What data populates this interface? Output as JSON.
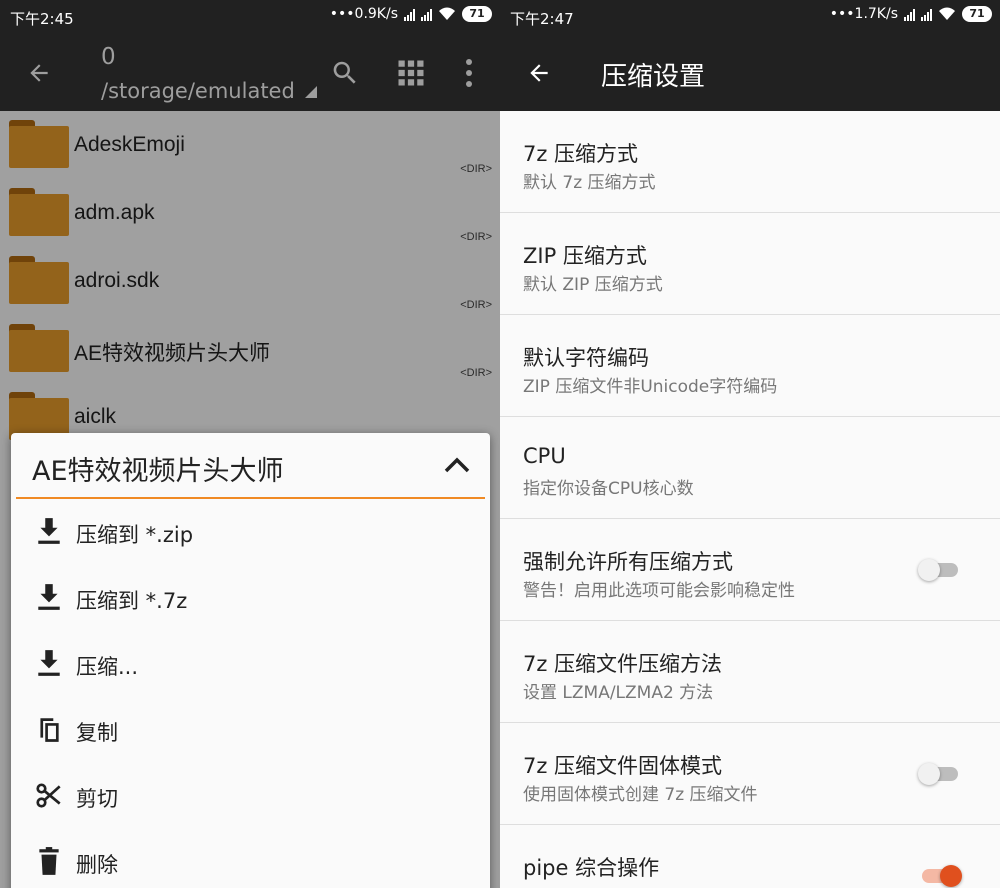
{
  "left": {
    "status": {
      "time": "下午2:45",
      "speed": "0.9K/s",
      "battery": "71"
    },
    "header": {
      "count": "0",
      "path": "/storage/emulated"
    },
    "files": [
      {
        "name": "AdeskEmoji",
        "tag": "<DIR>"
      },
      {
        "name": "adm.apk",
        "tag": "<DIR>"
      },
      {
        "name": "adroi.sdk",
        "tag": "<DIR>"
      },
      {
        "name": "AE特效视频片头大师",
        "tag": "<DIR>"
      },
      {
        "name": "aiclk",
        "tag": ""
      }
    ],
    "menu": {
      "title": "AE特效视频片头大师",
      "items": [
        {
          "label": "压缩到 *.zip",
          "icon": "download-icon"
        },
        {
          "label": "压缩到 *.7z",
          "icon": "download-icon"
        },
        {
          "label": "压缩...",
          "icon": "download-icon"
        },
        {
          "label": "复制",
          "icon": "copy-icon"
        },
        {
          "label": "剪切",
          "icon": "scissors-icon"
        },
        {
          "label": "删除",
          "icon": "trash-icon"
        }
      ]
    }
  },
  "right": {
    "status": {
      "time": "下午2:47",
      "speed": "1.7K/s",
      "battery": "71"
    },
    "header": {
      "title": "压缩设置"
    },
    "settings": [
      {
        "title": "7z 压缩方式",
        "subtitle": "默认 7z 压缩方式",
        "toggle": null
      },
      {
        "title": "ZIP 压缩方式",
        "subtitle": "默认 ZIP 压缩方式",
        "toggle": null
      },
      {
        "title": "默认字符编码",
        "subtitle": "ZIP 压缩文件非Unicode字符编码",
        "toggle": null
      },
      {
        "title": "CPU",
        "subtitle": "指定你设备CPU核心数",
        "toggle": null
      },
      {
        "title": "强制允许所有压缩方式",
        "subtitle": "警告！启用此选项可能会影响稳定性",
        "toggle": false
      },
      {
        "title": "7z 压缩文件压缩方法",
        "subtitle": "设置 LZMA/LZMA2 方法",
        "toggle": null
      },
      {
        "title": "7z 压缩文件固体模式",
        "subtitle": "使用固体模式创建 7z 压缩文件",
        "toggle": false
      },
      {
        "title": "pipe 综合操作",
        "subtitle": "",
        "toggle": true
      }
    ]
  },
  "colors": {
    "accent": "#f08a24",
    "toggle_on": "#e0501e",
    "appbar": "#212121",
    "folder": "#e69b2b"
  }
}
